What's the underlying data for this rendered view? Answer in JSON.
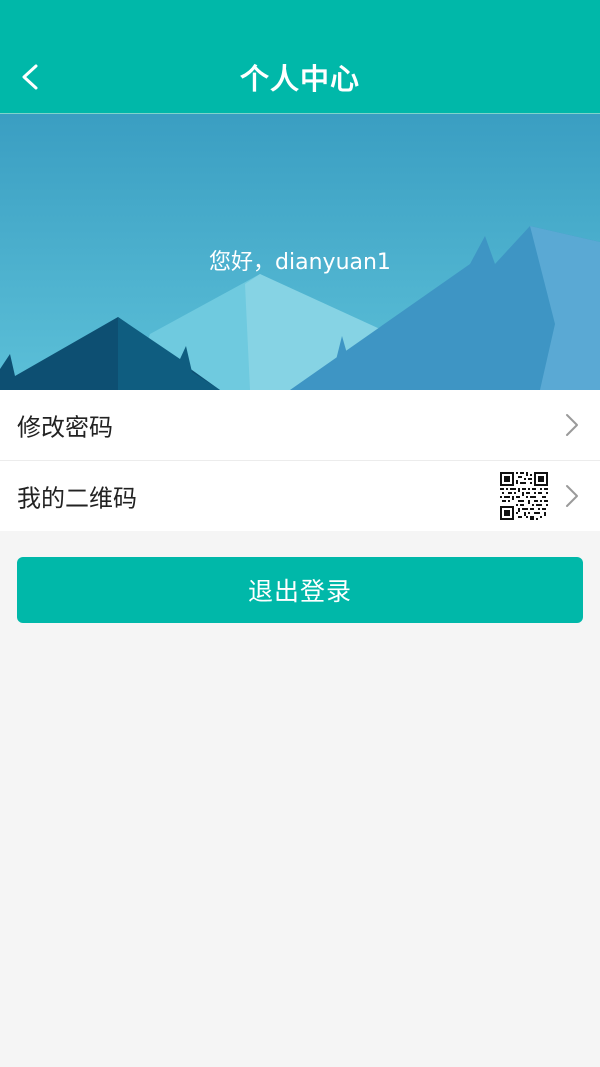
{
  "header": {
    "title": "个人中心",
    "back_icon": "chevron-left-icon",
    "color": "#00b8a9"
  },
  "hero": {
    "greeting": "您好，dianyuan1"
  },
  "menu": {
    "items": [
      {
        "label": "修改密码",
        "icon": "chevron-right-icon"
      },
      {
        "label": "我的二维码",
        "icon": "qr-code-icon"
      }
    ]
  },
  "logout": {
    "label": "退出登录",
    "color": "#00b8a9"
  }
}
